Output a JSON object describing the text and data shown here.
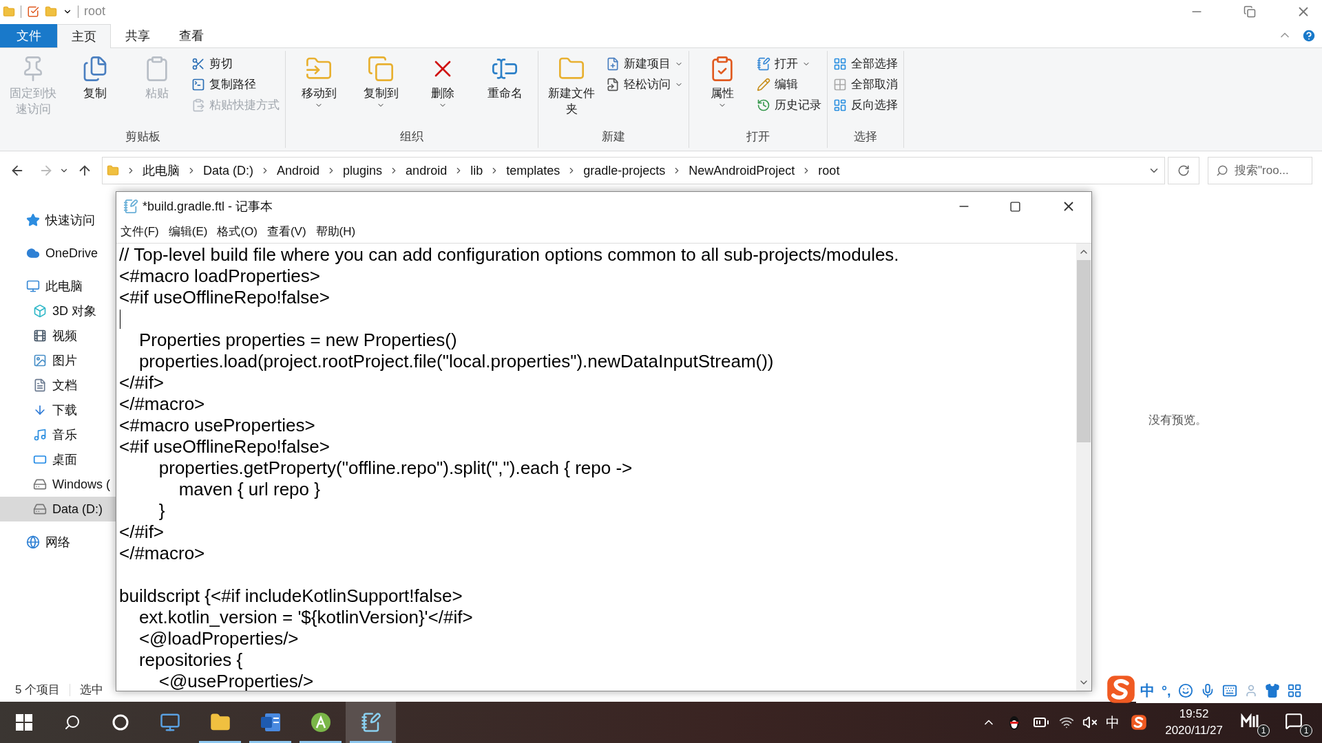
{
  "title_bar": {
    "title": "root"
  },
  "ribbon_tabs": [
    {
      "label": "文件",
      "kind": "file",
      "selected": false
    },
    {
      "label": "主页",
      "kind": "tab",
      "selected": true
    },
    {
      "label": "共享",
      "kind": "tab",
      "selected": false
    },
    {
      "label": "查看",
      "kind": "tab",
      "selected": false
    }
  ],
  "ribbon_groups": [
    {
      "label": "剪贴板",
      "buttons": [
        {
          "label": "固定到快速访问",
          "kind": "large",
          "disabled": true,
          "dropdown": false
        },
        {
          "label": "复制",
          "kind": "large",
          "disabled": false,
          "dropdown": false
        },
        {
          "label": "粘贴",
          "kind": "large",
          "disabled": true,
          "dropdown": false
        },
        {
          "label": "剪切",
          "kind": "small",
          "disabled": false,
          "dropdown": false
        },
        {
          "label": "复制路径",
          "kind": "small",
          "disabled": false,
          "dropdown": false
        },
        {
          "label": "粘贴快捷方式",
          "kind": "small",
          "disabled": true,
          "dropdown": false
        }
      ]
    },
    {
      "label": "组织",
      "buttons": [
        {
          "label": "移动到",
          "kind": "large",
          "disabled": false,
          "dropdown": true
        },
        {
          "label": "复制到",
          "kind": "large",
          "disabled": false,
          "dropdown": true
        },
        {
          "label": "删除",
          "kind": "large",
          "disabled": false,
          "dropdown": true
        },
        {
          "label": "重命名",
          "kind": "large",
          "disabled": false,
          "dropdown": false
        }
      ]
    },
    {
      "label": "新建",
      "buttons": [
        {
          "label": "新建文件夹",
          "kind": "large",
          "disabled": false,
          "dropdown": false
        },
        {
          "label": "新建项目",
          "kind": "small",
          "disabled": false,
          "dropdown": true
        },
        {
          "label": "轻松访问",
          "kind": "small",
          "disabled": false,
          "dropdown": true
        }
      ]
    },
    {
      "label": "打开",
      "buttons": [
        {
          "label": "属性",
          "kind": "large",
          "disabled": false,
          "dropdown": true
        },
        {
          "label": "打开",
          "kind": "small",
          "disabled": false,
          "dropdown": true
        },
        {
          "label": "编辑",
          "kind": "small",
          "disabled": false,
          "dropdown": false
        },
        {
          "label": "历史记录",
          "kind": "small",
          "disabled": false,
          "dropdown": false
        }
      ]
    },
    {
      "label": "选择",
      "buttons": [
        {
          "label": "全部选择",
          "kind": "small",
          "disabled": false,
          "dropdown": false
        },
        {
          "label": "全部取消",
          "kind": "small",
          "disabled": false,
          "dropdown": false
        },
        {
          "label": "反向选择",
          "kind": "small",
          "disabled": false,
          "dropdown": false
        }
      ]
    }
  ],
  "address_bar": {
    "path": [
      "此电脑",
      "Data (D:)",
      "Android",
      "plugins",
      "android",
      "lib",
      "templates",
      "gradle-projects",
      "NewAndroidProject",
      "root"
    ],
    "search_placeholder": "搜索\"roo..."
  },
  "navigation_pane": {
    "items": [
      {
        "label": "快速访问",
        "selected": false
      },
      {
        "label": "OneDrive",
        "selected": false
      },
      {
        "label": "此电脑",
        "selected": false,
        "children": [
          {
            "label": "3D 对象",
            "selected": false
          },
          {
            "label": "视频",
            "selected": false
          },
          {
            "label": "图片",
            "selected": false
          },
          {
            "label": "文档",
            "selected": false
          },
          {
            "label": "下载",
            "selected": false
          },
          {
            "label": "音乐",
            "selected": false
          },
          {
            "label": "桌面",
            "selected": false
          },
          {
            "label": "Windows (",
            "selected": false
          },
          {
            "label": "Data (D:)",
            "selected": true
          }
        ]
      },
      {
        "label": "网络",
        "selected": false
      }
    ]
  },
  "preview_pane": {
    "message": "没有预览。"
  },
  "status_bar": {
    "item_count": "5 个项目",
    "selection": "选中"
  },
  "notepad": {
    "title": "*build.gradle.ftl - 记事本",
    "menu": [
      "文件(F)",
      "编辑(E)",
      "格式(O)",
      "查看(V)",
      "帮助(H)"
    ],
    "lines": [
      {
        "kind": "text",
        "text": "// Top-level build file where you can add configuration options common to all sub-projects/modules."
      },
      {
        "kind": "text",
        "text": "<#macro loadProperties>"
      },
      {
        "kind": "text",
        "text": "<#if useOfflineRepo!false>"
      },
      {
        "kind": "cursor"
      },
      {
        "kind": "text",
        "text": "    Properties properties = new Properties()"
      },
      {
        "kind": "text",
        "text": "    properties.load(project.rootProject.file(\"local.properties\").newDataInputStream())"
      },
      {
        "kind": "text",
        "text": "</#if>"
      },
      {
        "kind": "text",
        "text": "</#macro>"
      },
      {
        "kind": "text",
        "text": "<#macro useProperties>"
      },
      {
        "kind": "text",
        "text": "<#if useOfflineRepo!false>"
      },
      {
        "kind": "text",
        "text": "        properties.getProperty(\"offline.repo\").split(\",\").each { repo ->"
      },
      {
        "kind": "text",
        "text": "            maven { url repo }"
      },
      {
        "kind": "text",
        "text": "        }"
      },
      {
        "kind": "text",
        "text": "</#if>"
      },
      {
        "kind": "text",
        "text": "</#macro>"
      },
      {
        "kind": "blank"
      },
      {
        "kind": "text",
        "text": "buildscript {<#if includeKotlinSupport!false>"
      },
      {
        "kind": "text",
        "text": "    ext.kotlin_version = '${kotlinVersion}'</#if>"
      },
      {
        "kind": "text",
        "text": "    <@loadProperties/>"
      },
      {
        "kind": "text",
        "text": "    repositories {"
      },
      {
        "kind": "text",
        "text": "        <@useProperties/>"
      }
    ]
  },
  "ime_toolbar": {
    "mode": "中",
    "punctuation": "°,"
  },
  "taskbar": {
    "apps": [
      {
        "running": false,
        "selected": false
      },
      {
        "running": true,
        "selected": false
      },
      {
        "running": true,
        "selected": false
      },
      {
        "running": true,
        "selected": false
      },
      {
        "running": true,
        "selected": true
      }
    ],
    "tray": {
      "language": "中",
      "time": "19:52",
      "date": "2020/11/27",
      "im_badge": "1",
      "notification_badge": "1"
    }
  }
}
